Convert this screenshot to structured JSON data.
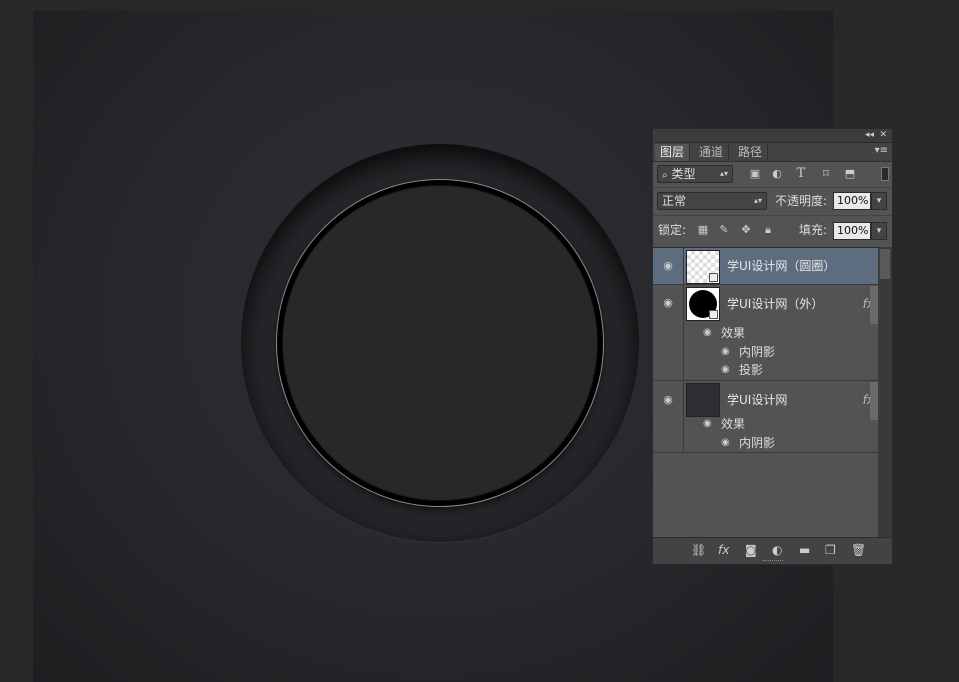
{
  "panel": {
    "collapse_icon": "double-chevron-left-icon",
    "close_icon": "close-icon",
    "tabs": [
      {
        "label": "图层",
        "active": true
      },
      {
        "label": "通道",
        "active": false
      },
      {
        "label": "路径",
        "active": false
      }
    ],
    "menu_icon": "panel-menu-icon"
  },
  "filter": {
    "kind_label": "类型",
    "search_icon": "search-icon"
  },
  "blend": {
    "mode": "正常",
    "opacity_label": "不透明度:",
    "opacity_value": "100%"
  },
  "lock": {
    "label": "锁定:",
    "fill_label": "填充:",
    "fill_value": "100%"
  },
  "layers": [
    {
      "name": "学UI设计网（圆圈）",
      "selected": true,
      "fx": ""
    },
    {
      "name": "学UI设计网（外）",
      "selected": false,
      "fx": "fx",
      "effects_label": "效果",
      "effects": [
        "内阴影",
        "投影"
      ]
    },
    {
      "name": "学UI设计网",
      "selected": false,
      "fx": "fx",
      "effects_label": "效果",
      "effects": [
        "内阴影"
      ]
    }
  ],
  "colors": {
    "selected_layer": "#5e6c80",
    "panel_bg": "#535353",
    "canvas_bg": "#28282c"
  }
}
